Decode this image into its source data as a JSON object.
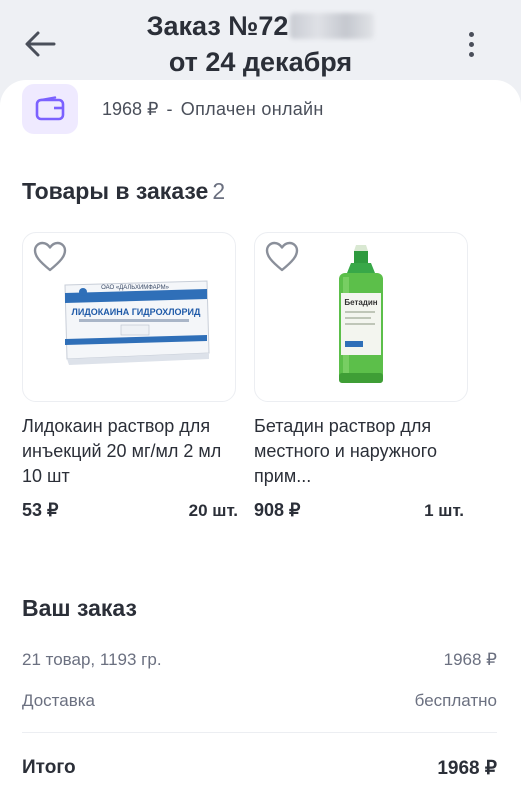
{
  "header": {
    "title_prefix": "Заказ №72",
    "title_line2": "от 24 декабря"
  },
  "payment": {
    "icon": "wallet-icon",
    "amount": "1968 ₽",
    "dash": "-",
    "status": "Оплачен онлайн"
  },
  "products_section": {
    "title": "Товары в заказе",
    "count": "2"
  },
  "products": [
    {
      "name": "Лидокаин раствор для инъекций 20 мг/мл 2 мл 10 шт",
      "price": "53 ₽",
      "qty": "20 шт.",
      "box_maker": "ОАО «ДАЛЬХИМФАРМ»",
      "box_title": "ЛИДОКАИНА ГИДРОХЛОРИД"
    },
    {
      "name": "Бетадин раствор для местного и наружного прим...",
      "price": "908 ₽",
      "qty": "1 шт.",
      "bottle_label": "Бетадин"
    }
  ],
  "summary": {
    "title": "Ваш заказ",
    "items_label": "21 товар, 1193 гр.",
    "items_value": "1968 ₽",
    "delivery_label": "Доставка",
    "delivery_value": "бесплатно",
    "total_label": "Итого",
    "total_value": "1968 ₽"
  },
  "colors": {
    "accent_purple": "#7b61ff",
    "wallet_bg": "#efeaff",
    "text_main": "#2b2f38",
    "text_muted": "#6b7080"
  }
}
